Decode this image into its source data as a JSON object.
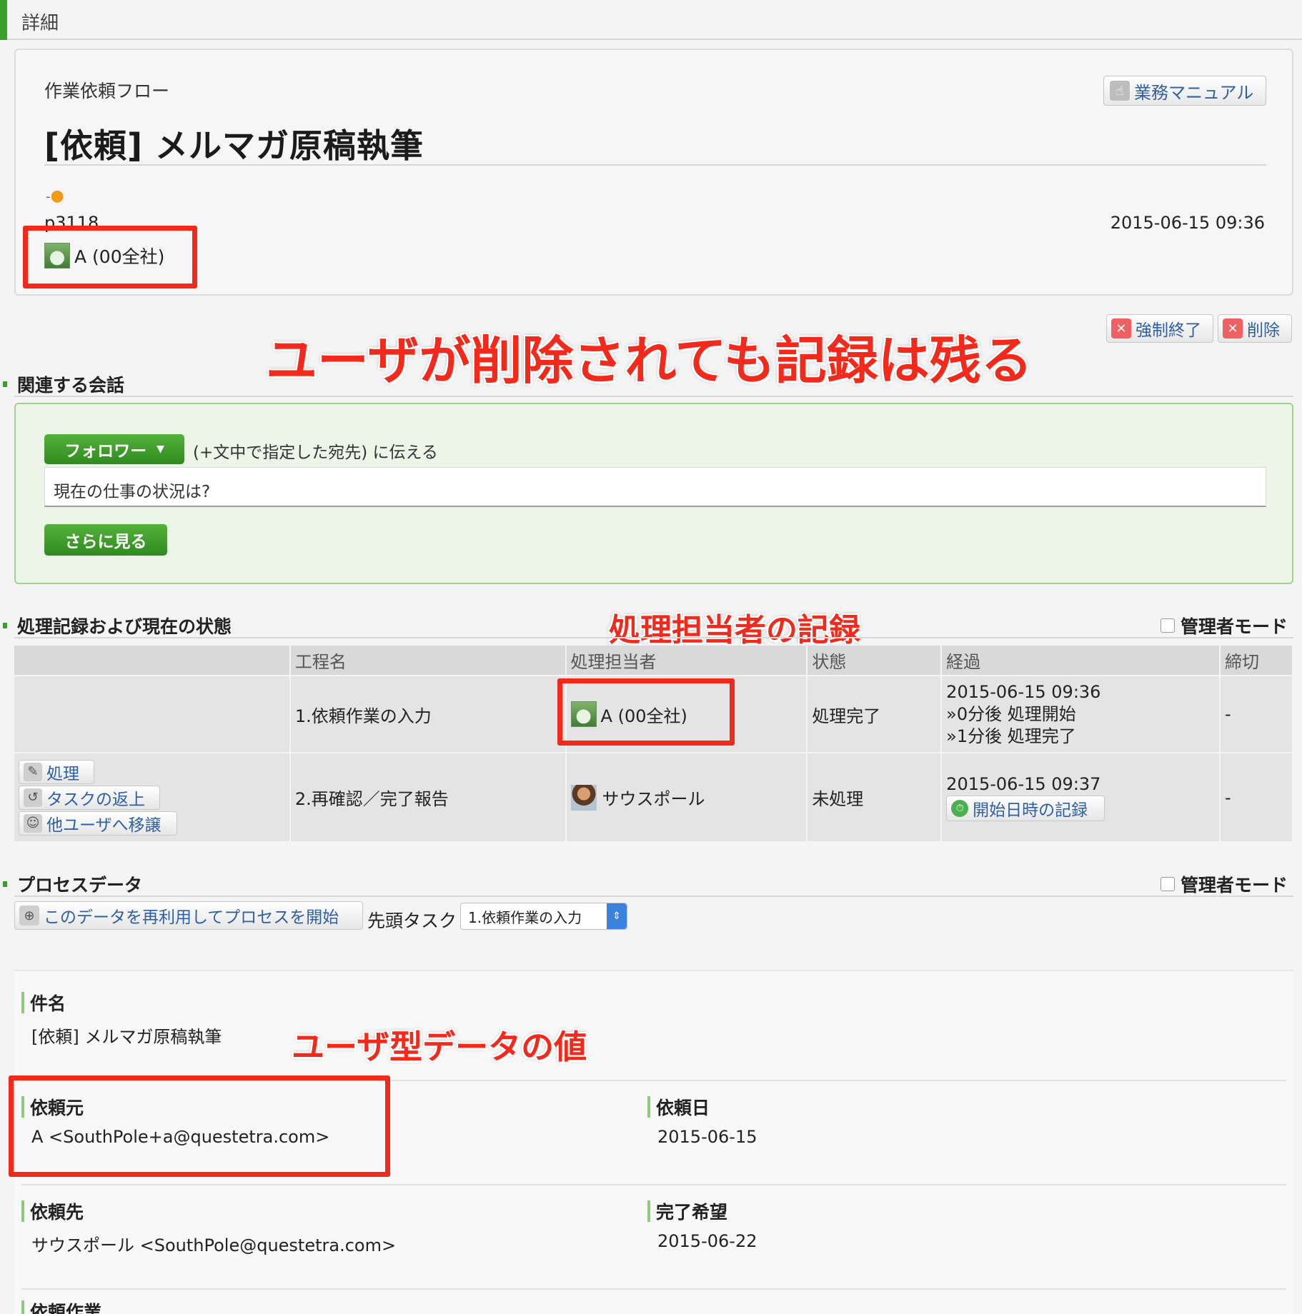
{
  "header": {
    "title": "詳細"
  },
  "card": {
    "flow_name": "作業依頼フロー",
    "manual_button": "業務マニュアル",
    "title": "[依頼] メルマガ原稿執筆",
    "process_id": "p3118",
    "datetime": "2015-06-15 09:36",
    "user": "A (00全社)"
  },
  "annotations": {
    "deleted_user_note": "ユーザが削除されても記録は残る",
    "assignee_record_note": "処理担当者の記録",
    "user_type_note": "ユーザ型データの値"
  },
  "actions": {
    "force_end": "強制終了",
    "delete": "削除"
  },
  "conversation": {
    "section_title": "関連する会話",
    "followers_button": "フォロワー",
    "followers_note": "(+文中で指定した宛先) に伝える",
    "input_value": "現在の仕事の状況は?",
    "more_button": "さらに見る"
  },
  "history": {
    "section_title": "処理記録および現在の状態",
    "admin_mode": "管理者モード",
    "columns": [
      "",
      "工程名",
      "処理担当者",
      "状態",
      "経過",
      "締切"
    ],
    "rows": [
      {
        "step": "1.依頼作業の入力",
        "assignee": "A (00全社)",
        "status": "処理完了",
        "elapsed": [
          "2015-06-15 09:36",
          "»0分後 処理開始",
          "»1分後 処理完了"
        ],
        "deadline": "-"
      },
      {
        "buttons": [
          "処理",
          "タスクの返上",
          "他ユーザへ移譲"
        ],
        "step": "2.再確認／完了報告",
        "assignee": "サウスポール",
        "status": "未処理",
        "elapsed": [
          "2015-06-15 09:37"
        ],
        "record_button": "開始日時の記録",
        "deadline": "-"
      }
    ]
  },
  "process_data": {
    "section_title": "プロセスデータ",
    "admin_mode": "管理者モード",
    "reuse_button": "このデータを再利用してプロセスを開始",
    "first_task_label": "先頭タスク",
    "first_task_value": "1.依頼作業の入力",
    "fields": {
      "subject_label": "件名",
      "subject_value": "[依頼] メルマガ原稿執筆",
      "requester_label": "依頼元",
      "requester_value": "A <SouthPole+a@questetra.com>",
      "request_date_label": "依頼日",
      "request_date_value": "2015-06-15",
      "requestee_label": "依頼先",
      "requestee_value": "サウスポール <SouthPole@questetra.com>",
      "due_label": "完了希望",
      "due_value": "2015-06-22",
      "work_label": "依頼作業"
    }
  },
  "colors": {
    "accent_green": "#39a02c",
    "annotation_red": "#f2291b",
    "link_blue": "#2e5fa7"
  },
  "icons": [
    "hand-icon",
    "user-avatar-icon",
    "close-x-icon",
    "chevron-down-icon",
    "clock-icon",
    "reuse-icon"
  ]
}
